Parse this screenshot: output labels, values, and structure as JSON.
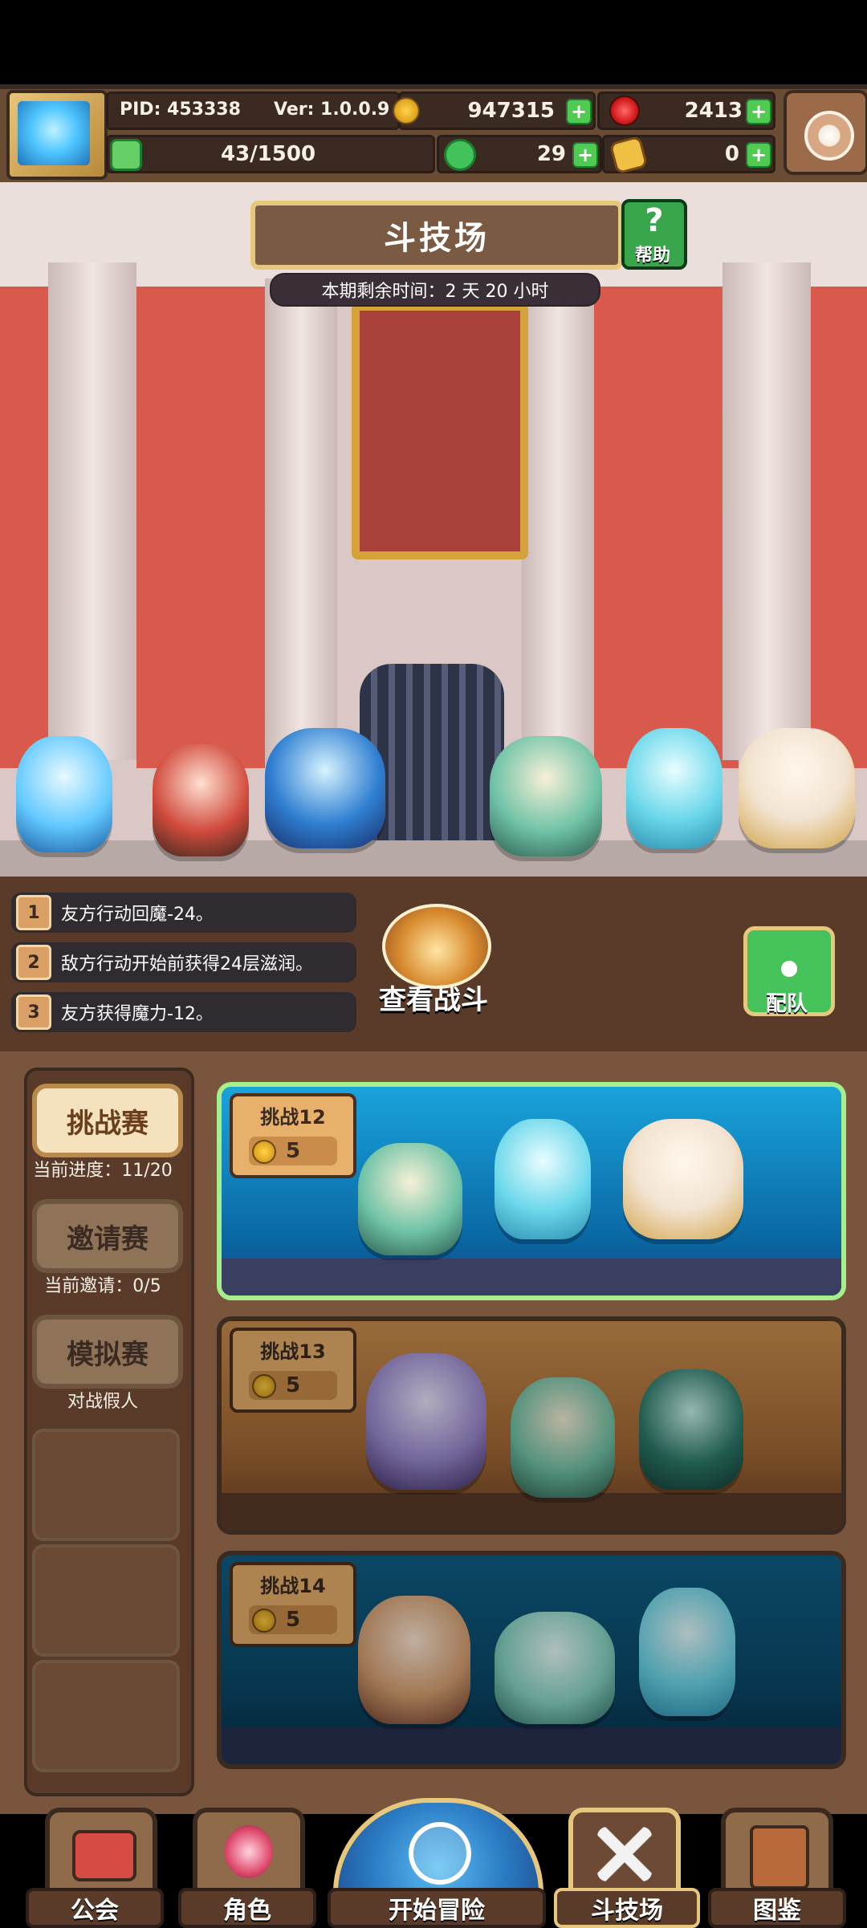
{
  "header": {
    "pid_label": "PID: 453338",
    "ver_label": "Ver: 1.0.0.9",
    "gold": "947315",
    "ruby": "2413",
    "stamina": "43/1500",
    "clover": "29",
    "hand": "0"
  },
  "arena": {
    "title": "斗技场",
    "help_label": "帮助",
    "remaining_time": "本期剩余时间：2 天 20 小时"
  },
  "rules": [
    {
      "num": "1",
      "text": "友方行动回魔-24。"
    },
    {
      "num": "2",
      "text": "敌方行动开始前获得24层滋润。"
    },
    {
      "num": "3",
      "text": "友方获得魔力-12。"
    }
  ],
  "view_battle_label": "查看战斗",
  "team_label": "配队",
  "modes": [
    {
      "label": "挑战赛",
      "sub": "当前进度：11/20",
      "state": "active"
    },
    {
      "label": "邀请赛",
      "sub": "当前邀请：0/5",
      "state": "inactive"
    },
    {
      "label": "模拟赛",
      "sub": "对战假人",
      "state": "inactive"
    }
  ],
  "challenges": [
    {
      "title": "挑战12",
      "cost": "5",
      "state": "active"
    },
    {
      "title": "挑战13",
      "cost": "5",
      "state": "inactive"
    },
    {
      "title": "挑战14",
      "cost": "5",
      "state": "inactive"
    }
  ],
  "nav": {
    "guild": "公会",
    "characters": "角色",
    "adventure": "开始冒险",
    "arena": "斗技场",
    "codex": "图鉴"
  },
  "colors": {
    "accent_green": "#4fcb51",
    "panel_brown": "#7a553d",
    "gold_border": "#e7c77c"
  },
  "icons": {
    "gold": "gold-coin-icon",
    "ruby": "ruby-icon",
    "stamina": "green-gem-icon",
    "clover": "clover-icon",
    "hand": "hand-icon",
    "settings": "gear-icon"
  }
}
